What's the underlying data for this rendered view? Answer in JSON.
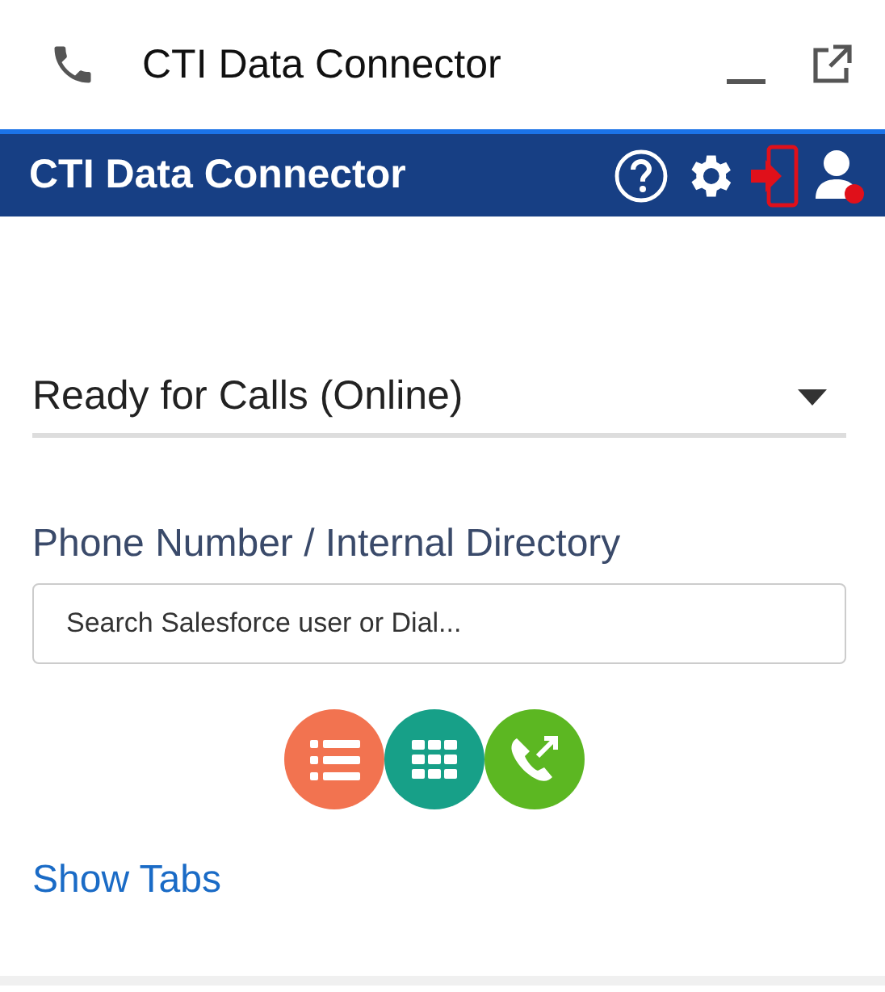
{
  "window": {
    "title": "CTI Data Connector"
  },
  "header": {
    "title": "CTI Data Connector"
  },
  "status": {
    "value": "Ready for Calls (Online)"
  },
  "directory": {
    "label": "Phone Number / Internal Directory",
    "placeholder": "Search Salesforce user or Dial..."
  },
  "actions": [
    {
      "kind": "list"
    },
    {
      "kind": "dialpad"
    },
    {
      "kind": "call"
    }
  ],
  "link": "Show Tabs"
}
